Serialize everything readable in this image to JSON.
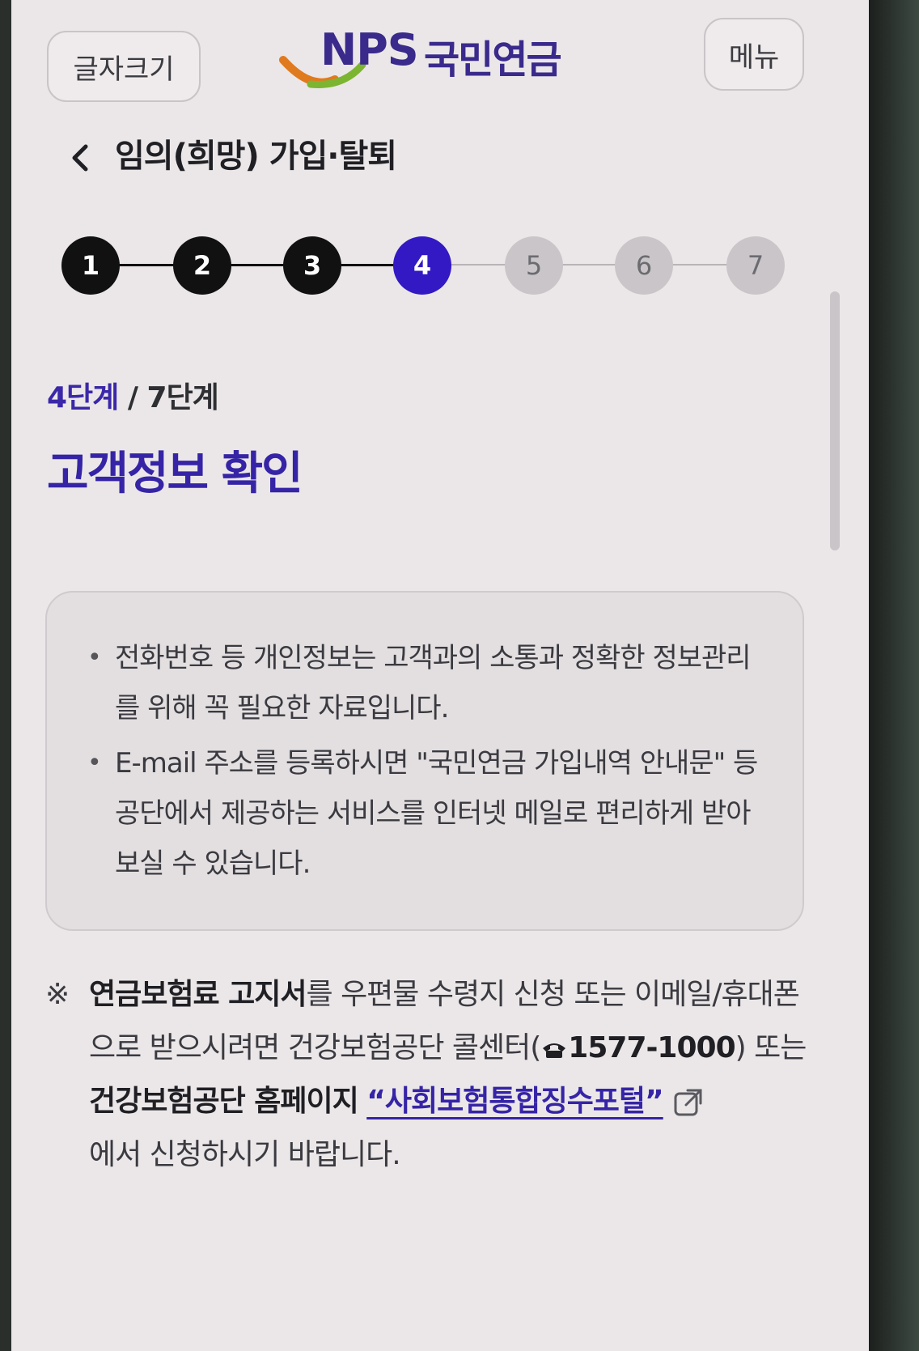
{
  "header": {
    "font_size_button": "글자크기",
    "menu_button": "메뉴",
    "logo": {
      "brand": "NPS",
      "name": "국민연금"
    }
  },
  "nav": {
    "back_icon": "chevron-left-icon",
    "title": "임의(희망) 가입·탈퇴"
  },
  "stepper": {
    "steps": [
      "1",
      "2",
      "3",
      "4",
      "5",
      "6",
      "7"
    ],
    "current": 4,
    "colors": {
      "done": "#111111",
      "current": "#3319c4",
      "todo": "#c9c5c8"
    }
  },
  "progress": {
    "current_label": "4단계",
    "separator": " / ",
    "total_label": "7단계"
  },
  "section_title": "고객정보 확인",
  "info": {
    "items": [
      "전화번호 등 개인정보는 고객과의 소통과 정확한 정보관리를 위해 꼭 필요한 자료입니다.",
      "E-mail 주소를 등록하시면 \"국민연금 가입내역 안내문\" 등 공단에서 제공하는 서비스를 인터넷 메일로 편리하게 받아 보실 수 있습니다."
    ]
  },
  "notice": {
    "mark": "※",
    "bold1": "연금보험료 고지서",
    "text1": "를 우편물 수령지 신청 또는 이메일/휴대폰으로 받으시려면 건강보험공단 콜센터(",
    "phone_icon": "phone-icon",
    "phone": "1577-1000",
    "text2": ") 또는",
    "bold2": "건강보험공단 홈페이지",
    "link": "“사회보험통합징수포털”",
    "link_icon": "external-link-icon",
    "text3": "에서 신청하시기 바랍니다."
  }
}
